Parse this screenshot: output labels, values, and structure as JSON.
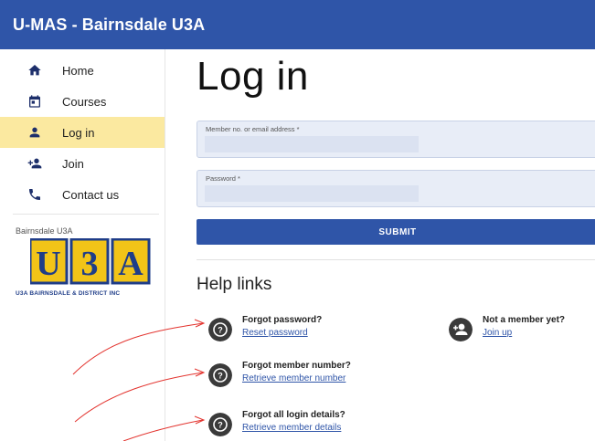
{
  "app": {
    "title": "U-MAS - Bairnsdale U3A"
  },
  "sidebar": {
    "items": [
      {
        "label": "Home",
        "icon": "home-icon"
      },
      {
        "label": "Courses",
        "icon": "calendar-icon"
      },
      {
        "label": "Log in",
        "icon": "person-icon",
        "active": true
      },
      {
        "label": "Join",
        "icon": "person-add-icon"
      },
      {
        "label": "Contact us",
        "icon": "phone-icon"
      }
    ],
    "org_name": "Bairnsdale U3A",
    "logo_caption": "U3A BAIRNSDALE & DISTRICT INC",
    "logo_letters": [
      "U",
      "3",
      "A"
    ]
  },
  "login": {
    "title": "Log in",
    "member_field": {
      "label": "Member no. or email address *",
      "value": ""
    },
    "password_field": {
      "label": "Password *",
      "value": ""
    },
    "submit_label": "SUBMIT"
  },
  "help": {
    "title": "Help links",
    "items": [
      {
        "question": "Forgot password?",
        "link": "Reset password",
        "icon": "help-circle-icon"
      },
      {
        "question": "Not a member yet?",
        "link": "Join up",
        "icon": "person-add-circle-icon"
      },
      {
        "question": "Forgot member number?",
        "link": "Retrieve member number",
        "icon": "help-circle-icon"
      },
      {
        "question": "Forgot all login details?",
        "link": "Retrieve member details",
        "icon": "help-circle-icon"
      }
    ]
  },
  "colors": {
    "brand": "#2f55a8",
    "active_nav": "#fbe9a0",
    "logo_yellow": "#f2c418",
    "annotation": "#e3342f"
  }
}
